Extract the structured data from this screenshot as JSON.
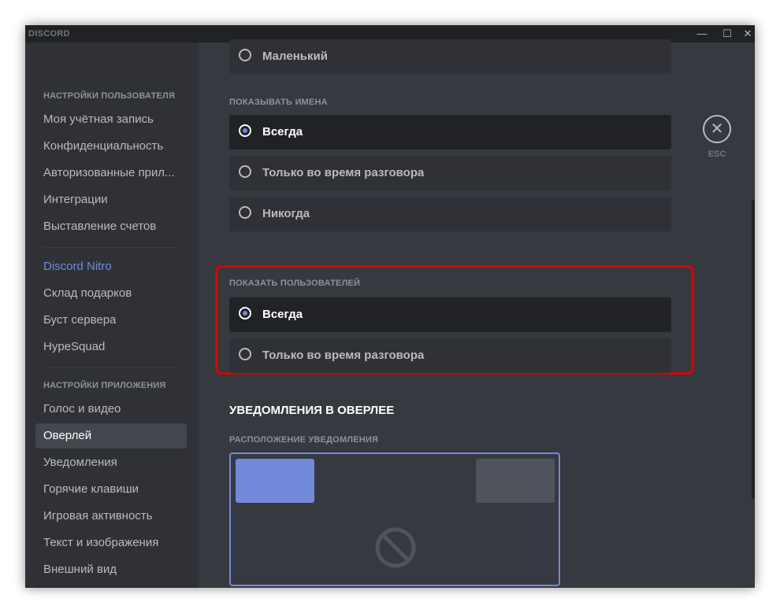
{
  "window": {
    "app_name": "DISCORD",
    "controls": {
      "minimize": "—",
      "maximize": "☐",
      "close": "✕"
    }
  },
  "sidebar": {
    "user_settings_header": "НАСТРОЙКИ ПОЛЬЗОВАТЕЛЯ",
    "user_items": [
      "Моя учётная запись",
      "Конфиденциальность",
      "Авторизованные прил...",
      "Интеграции",
      "Выставление счетов"
    ],
    "nitro_items": [
      "Discord Nitro",
      "Склад подарков",
      "Буст сервера",
      "HypeSquad"
    ],
    "app_settings_header": "НАСТРОЙКИ ПРИЛОЖЕНИЯ",
    "app_items": [
      "Голос и видео",
      "Оверлей",
      "Уведомления",
      "Горячие клавиши",
      "Игровая активность",
      "Текст и изображения",
      "Внешний вид"
    ],
    "active_item": "Оверлей"
  },
  "main": {
    "avatar_size_partial": {
      "label": "Маленький"
    },
    "show_names": {
      "title": "ПОКАЗЫВАТЬ ИМЕНА",
      "options": [
        "Всегда",
        "Только во время разговора",
        "Никогда"
      ],
      "selected": "Всегда"
    },
    "show_users": {
      "title": "ПОКАЗАТЬ ПОЛЬЗОВАТЕЛЕЙ",
      "options": [
        "Всегда",
        "Только во время разговора"
      ],
      "selected": "Всегда"
    },
    "notifications": {
      "title": "УВЕДОМЛЕНИЯ В ОВЕРЛЕЕ",
      "position_title": "РАСПОЛОЖЕНИЕ УВЕДОМЛЕНИЯ",
      "selected_position": "top-left"
    }
  },
  "close": {
    "icon": "close-icon",
    "label": "ESC"
  },
  "colors": {
    "accent": "#7289da",
    "highlight": "#e00000",
    "background": "#36393f",
    "sidebar": "#2f3136"
  }
}
